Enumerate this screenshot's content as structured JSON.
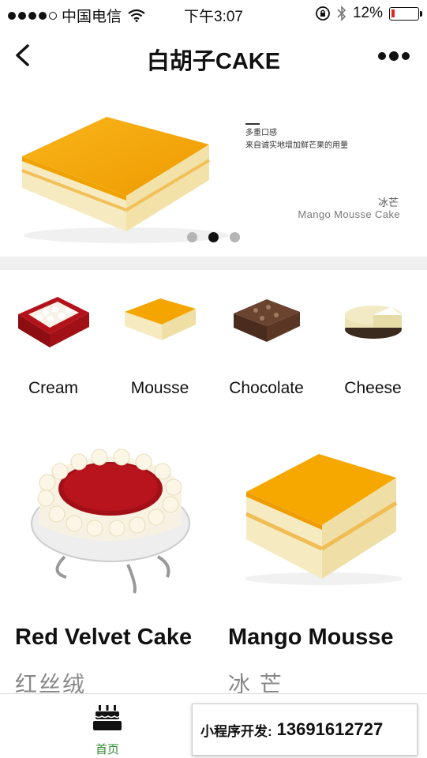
{
  "status_bar": {
    "carrier": "中国电信",
    "time": "下午3:07",
    "battery": "12%",
    "battery_level": 0.12
  },
  "nav": {
    "title": "白胡子CAKE"
  },
  "banner": {
    "tagline_1": "多重口感",
    "tagline_2": "来自诚实地增加鲜芒果的用量",
    "name_cn": "冰芒",
    "name_en": "Mango Mousse Cake",
    "page_count": 3,
    "active_page": 2
  },
  "categories": [
    {
      "label": "Cream"
    },
    {
      "label": "Mousse"
    },
    {
      "label": "Chocolate"
    },
    {
      "label": "Cheese"
    }
  ],
  "products": [
    {
      "name": "Red Velvet Cake",
      "name_cn": "红丝绒"
    },
    {
      "name": "Mango Mousse",
      "name_cn": "冰 芒"
    }
  ],
  "tabbar": {
    "home_label": "首页",
    "promo_label": "小程序开发:",
    "promo_phone": "13691612727"
  },
  "colors": {
    "mango": "#f5a500",
    "cream": "#f6edc8",
    "red_velvet": "#b3121a",
    "tab_active": "#2e8b2e"
  }
}
